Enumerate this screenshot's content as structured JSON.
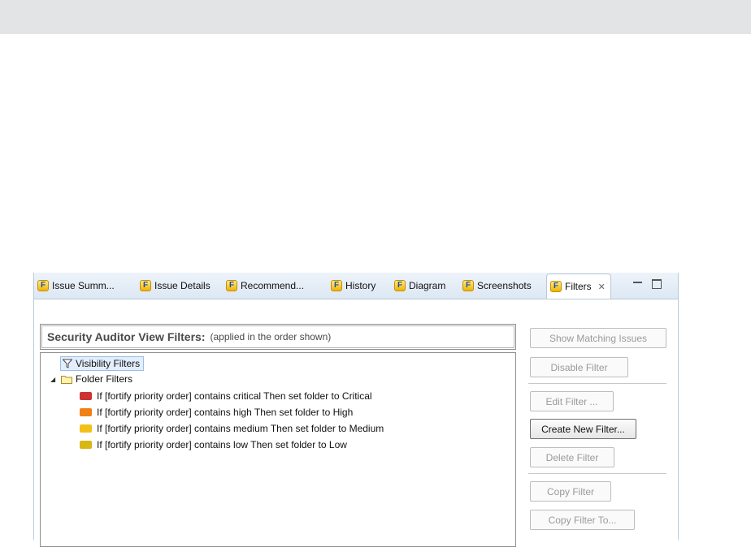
{
  "tabs": [
    {
      "label": "Issue Summ...",
      "active": false
    },
    {
      "label": "Issue Details",
      "active": false
    },
    {
      "label": "Recommend...",
      "active": false
    },
    {
      "label": "History",
      "active": false
    },
    {
      "label": "Diagram",
      "active": false
    },
    {
      "label": "Screenshots",
      "active": false
    },
    {
      "label": "Filters",
      "active": true
    }
  ],
  "tab_icon_letter": "F",
  "close_glyph": "✕",
  "panel": {
    "title": "Security Auditor View Filters:",
    "subtitle": "(applied in the order shown)"
  },
  "tree": {
    "visibility_label": "Visibility Filters",
    "folder_label": "Folder Filters",
    "expander_glyph": "◢",
    "rules": [
      {
        "text": "If [fortify priority order] contains critical Then set folder to Critical",
        "color": "#cc3333"
      },
      {
        "text": "If [fortify priority order] contains high Then set folder to High",
        "color": "#f07f15"
      },
      {
        "text": "If [fortify priority order] contains medium Then set folder to Medium",
        "color": "#f2c018"
      },
      {
        "text": "If [fortify priority order] contains low Then set folder to Low",
        "color": "#d8b613"
      }
    ]
  },
  "buttons": {
    "show_matching": "Show Matching Issues",
    "disable": "Disable Filter",
    "edit": "Edit Filter ...",
    "create": "Create New Filter...",
    "delete": "Delete Filter",
    "copy": "Copy Filter",
    "copy_to": "Copy Filter To..."
  }
}
